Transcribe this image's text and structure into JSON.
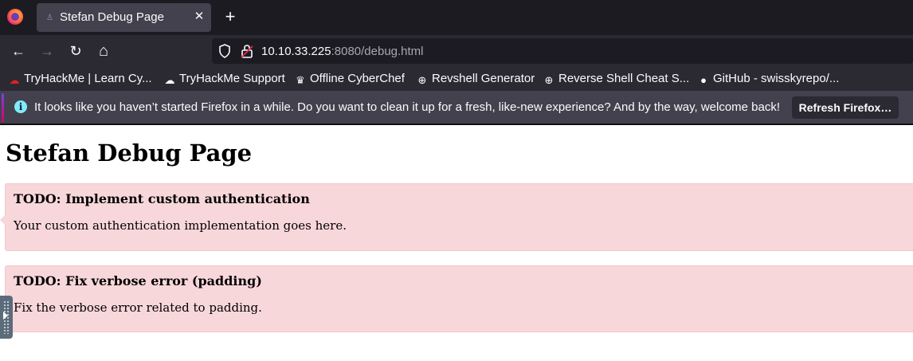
{
  "browser": {
    "tab": {
      "title": "Stefan Debug Page",
      "close_glyph": "✕"
    },
    "newtab_glyph": "+",
    "url": {
      "host": "10.10.33.225",
      "rest": ":8080/debug.html"
    },
    "nav": {
      "back": "←",
      "forward": "→",
      "reload": "↻",
      "home": "⌂"
    }
  },
  "bookmarks": [
    {
      "label": "TryHackMe | Learn Cy...",
      "icon": "tryhackme-icon"
    },
    {
      "label": "TryHackMe Support",
      "icon": "cloud-icon"
    },
    {
      "label": "Offline CyberChef",
      "icon": "chef-hat-icon"
    },
    {
      "label": "Revshell Generator",
      "icon": "globe-icon"
    },
    {
      "label": "Reverse Shell Cheat S...",
      "icon": "globe-icon"
    },
    {
      "label": "GitHub - swisskyrepo/...",
      "icon": "github-icon"
    }
  ],
  "notification": {
    "text": "It looks like you haven’t started Firefox in a while. Do you want to clean it up for a fresh, like-new experience? And by the way, welcome back!",
    "button_label": "Refresh Firefox…",
    "info_glyph": "i"
  },
  "page": {
    "title": "Stefan Debug Page",
    "todos": [
      {
        "heading": "TODO: Implement custom authentication",
        "text": "Your custom authentication implementation goes here."
      },
      {
        "heading": "TODO: Fix verbose error (padding)",
        "text": "Fix the verbose error related to padding."
      }
    ]
  },
  "colors": {
    "todo_background": "#f8d7da",
    "chrome_dark": "#1c1b22",
    "chrome_mid": "#2b2a33"
  }
}
